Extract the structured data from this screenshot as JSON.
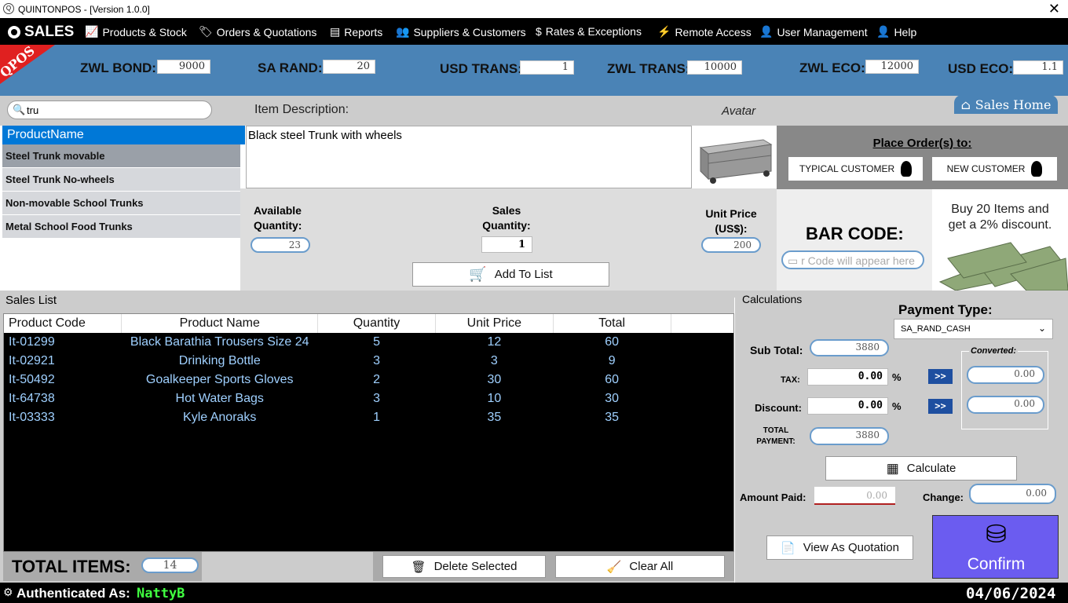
{
  "window": {
    "title": "QUINTONPOS - [Version 1.0.0]"
  },
  "menu": {
    "sales": "SALES",
    "products": "Products & Stock",
    "orders": "Orders & Quotations",
    "reports": "Reports",
    "suppliers": "Suppliers & Customers",
    "rates": "Rates & Exceptions",
    "remote": "Remote Access",
    "users": "User Management",
    "help": "Help"
  },
  "logo": "QPOS",
  "rates": {
    "zwl_bond_label": "ZWL BOND:",
    "zwl_bond": "9000",
    "sa_rand_label": "SA RAND:",
    "sa_rand": "20",
    "usd_trans_label": "USD TRANS:",
    "usd_trans": "1",
    "zwl_trans_label": "ZWL TRANS:",
    "zwl_trans": "10000",
    "zwl_eco_label": "ZWL ECO:",
    "zwl_eco": "12000",
    "usd_eco_label": "USD ECO:",
    "usd_eco": "1.1"
  },
  "search": {
    "value": "tru"
  },
  "product_list": {
    "header": "ProductName",
    "items": [
      "Steel Trunk movable",
      "Steel Trunk No-wheels",
      "Non-movable School Trunks",
      "Metal School Food Trunks"
    ]
  },
  "item": {
    "desc_label": "Item Description:",
    "description": "Black steel Trunk with wheels",
    "avatar_label": "Avatar"
  },
  "sales_home": "Sales Home",
  "order": {
    "title": "Place Order(s) to:",
    "typical": "TYPICAL CUSTOMER",
    "new": "NEW CUSTOMER"
  },
  "qty": {
    "available_label_1": "Available",
    "available_label_2": "Quantity:",
    "available": "23",
    "sales_label_1": "Sales",
    "sales_label_2": "Quantity:",
    "sales": "1",
    "price_label_1": "Unit Price",
    "price_label_2": "(US$):",
    "price": "200",
    "add": "Add To List"
  },
  "barcode": {
    "label": "BAR CODE:",
    "placeholder": "r Code will appear here"
  },
  "promo": {
    "line1": "Buy 20 Items and",
    "line2": "get a 2% discount."
  },
  "sales_list": {
    "title": "Sales List",
    "columns": [
      "Product Code",
      "Product Name",
      "Quantity",
      "Unit Price",
      "Total"
    ],
    "rows": [
      [
        "It-01299",
        "Black Barathia Trousers Size 24",
        "5",
        "12",
        "60"
      ],
      [
        "It-02921",
        "Drinking Bottle",
        "3",
        "3",
        "9"
      ],
      [
        "It-50492",
        "Goalkeeper Sports Gloves",
        "2",
        "30",
        "60"
      ],
      [
        "It-64738",
        "Hot Water Bags",
        "3",
        "10",
        "30"
      ],
      [
        "It-03333",
        "Kyle Anoraks",
        "1",
        "35",
        "35"
      ]
    ]
  },
  "total_items": {
    "label": "TOTAL ITEMS:",
    "value": "14"
  },
  "actions": {
    "delete": "Delete Selected",
    "clear": "Clear All"
  },
  "calc": {
    "title": "Calculations",
    "payment_type_label": "Payment Type:",
    "payment_type": "SA_RAND_CASH",
    "subtotal_label": "Sub Total:",
    "subtotal": "3880",
    "converted": "Converted:",
    "tax_label": "TAX:",
    "tax": "0.00",
    "tax_converted": "0.00",
    "discount_label": "Discount:",
    "discount": "0.00",
    "discount_converted": "0.00",
    "pct": "%",
    "arrow": ">>",
    "total_label_1": "TOTAL",
    "total_label_2": "PAYMENT:",
    "total": "3880",
    "calculate": "Calculate",
    "paid_label": "Amount Paid:",
    "paid": "0.00",
    "change_label": "Change:",
    "change": "0.00",
    "quotation": "View As Quotation",
    "confirm": "Confirm"
  },
  "status": {
    "auth_label": "Authenticated As:",
    "user": "NattyB",
    "date": "04/06/2024"
  }
}
